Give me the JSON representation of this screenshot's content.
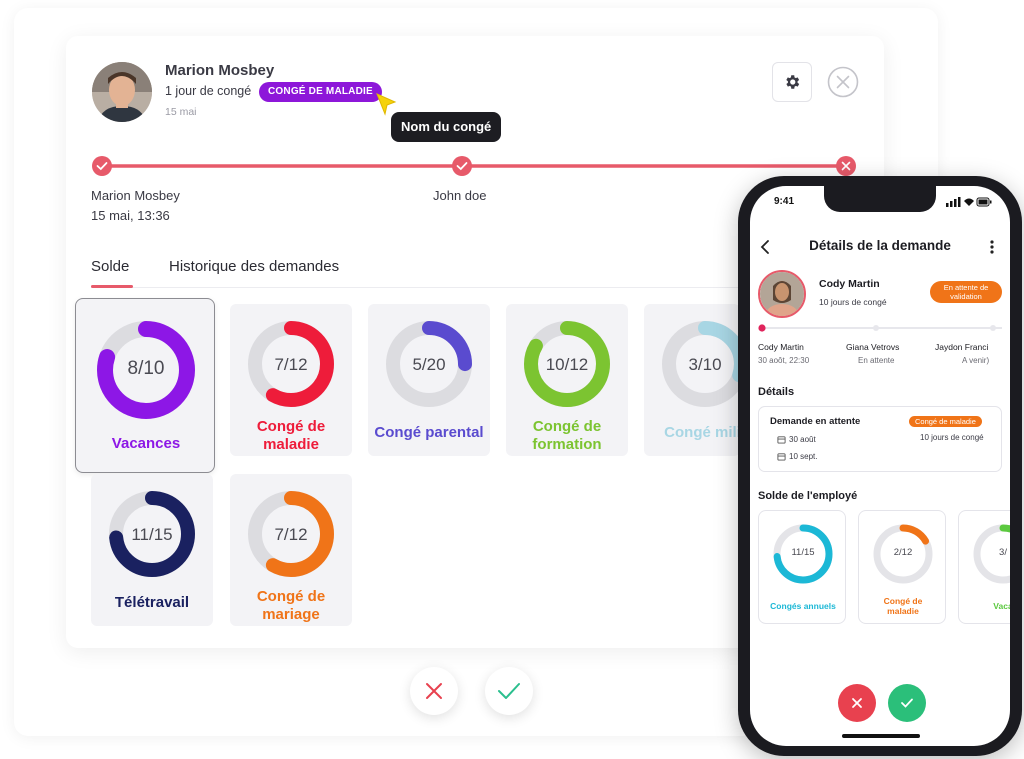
{
  "employee": {
    "name": "Marion Mosbey",
    "duration": "1 jour de congé",
    "leave_type_badge": "CONGÉ DE MALADIE",
    "date": "15 mai"
  },
  "tooltip": "Nom du congé",
  "timeline": {
    "steps": [
      {
        "name": "Marion Mosbey",
        "date": "15 mai, 13:36",
        "status": "approved"
      },
      {
        "name": "John doe",
        "date": "",
        "status": "approved"
      },
      {
        "name": "",
        "date": "",
        "status": "rejected"
      }
    ]
  },
  "tabs": [
    {
      "label": "Solde",
      "active": true
    },
    {
      "label": "Historique des demandes",
      "active": false
    }
  ],
  "balances": [
    {
      "value": "8/10",
      "fraction": 0.8,
      "label_l1": "Vacances",
      "label_l2": "",
      "color": "#8d17e6",
      "selected": true
    },
    {
      "value": "7/12",
      "fraction": 0.583,
      "label_l1": "Congé de",
      "label_l2": "maladie",
      "color": "#ee1c3a",
      "selected": false
    },
    {
      "value": "5/20",
      "fraction": 0.25,
      "label_l1": "Congé parental",
      "label_l2": "",
      "color": "#5a4bcf",
      "selected": false
    },
    {
      "value": "10/12",
      "fraction": 0.833,
      "label_l1": "Congé de",
      "label_l2": "formation",
      "color": "#7cc431",
      "selected": false
    },
    {
      "value": "3/10",
      "fraction": 0.3,
      "label_l1": "Congé milit",
      "label_l2": "",
      "color": "#a8d6e4",
      "selected": false
    },
    {
      "value": "11/15",
      "fraction": 0.733,
      "label_l1": "Télétravail",
      "label_l2": "",
      "color": "#1a2160",
      "selected": false
    },
    {
      "value": "7/12",
      "fraction": 0.583,
      "label_l1": "Congé de",
      "label_l2": "mariage",
      "color": "#f07418",
      "selected": false
    }
  ],
  "colors": {
    "accent": "#e75a6a",
    "reject": "#e8414f",
    "approve": "#2bbf8e",
    "badge": "#8d17d9",
    "pending": "#f07418"
  },
  "phone": {
    "time": "9:41",
    "title": "Détails de la demande",
    "employee": {
      "name": "Cody Martin",
      "duration": "10 jours de congé",
      "status_l1": "En attente de",
      "status_l2": "validation"
    },
    "steps": [
      {
        "name": "Cody Martin",
        "sub": "30 aoôt, 22:30"
      },
      {
        "name": "Giana Vetrovs",
        "sub": "En attente"
      },
      {
        "name": "Jaydon Franci",
        "sub": "A venir)"
      }
    ],
    "details_heading": "Détails",
    "request": {
      "title": "Demande en attente",
      "type": "Congé de maladie",
      "days": "10 jours de congé",
      "start": "30 août",
      "end": "10 sept."
    },
    "balance_heading": "Solde de l'employé",
    "balances": [
      {
        "value": "11/15",
        "fraction": 0.733,
        "label_l1": "Congés annuels",
        "label_l2": "",
        "color": "#1cb8d6"
      },
      {
        "value": "2/12",
        "fraction": 0.167,
        "label_l1": "Congé de",
        "label_l2": "maladie",
        "color": "#f07418"
      },
      {
        "value": "3/",
        "fraction": 0.3,
        "label_l1": "Vaca",
        "label_l2": "",
        "color": "#5cc940"
      }
    ]
  }
}
